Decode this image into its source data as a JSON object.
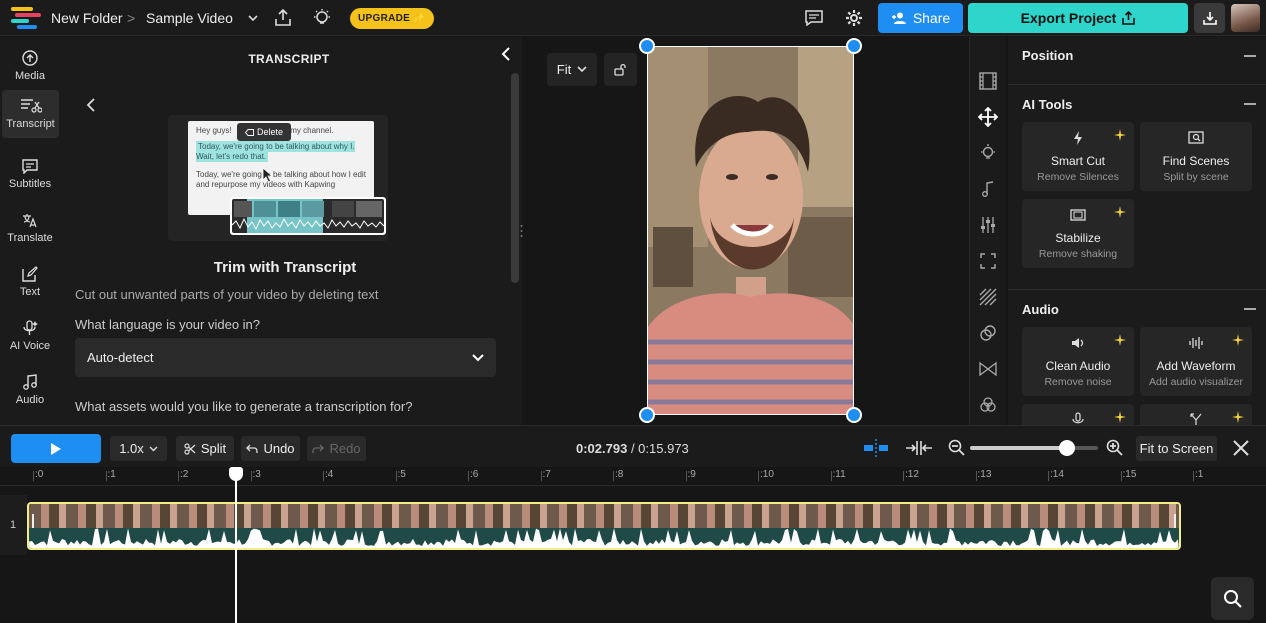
{
  "topbar": {
    "folder": "New Folder",
    "separator": ">",
    "project_name": "Sample Video",
    "upgrade_label": "UPGRADE ✨",
    "share_label": "Share",
    "export_label": "Export Project"
  },
  "left_rail": {
    "items": [
      {
        "label": "Media",
        "icon": "upload-icon"
      },
      {
        "label": "Transcript",
        "icon": "transcript-icon"
      },
      {
        "label": "Subtitles",
        "icon": "subtitles-icon"
      },
      {
        "label": "Translate",
        "icon": "translate-icon"
      },
      {
        "label": "Text",
        "icon": "text-edit-icon"
      },
      {
        "label": "AI Voice",
        "icon": "ai-voice-icon"
      },
      {
        "label": "Audio",
        "icon": "music-note-icon"
      }
    ]
  },
  "transcript": {
    "title": "TRANSCRIPT",
    "illustration": {
      "line1": "Hey guys!",
      "line1_end": "o my channel.",
      "delete_label": "Delete",
      "line2": "Today, we're going to be talking about why I. Wait, let's redo that.",
      "line3": "Today, we're going to be talking about how I edit and repurpose my videos with Kapwing"
    },
    "heading": "Trim with Transcript",
    "subtitle": "Cut out unwanted parts of your video by deleting text",
    "language_question": "What language is your video in?",
    "language_value": "Auto-detect",
    "assets_question": "What assets would you like to generate a transcription for?"
  },
  "preview": {
    "fit_label": "Fit"
  },
  "right_panel": {
    "position_title": "Position",
    "ai_tools_title": "AI Tools",
    "ai_tools": [
      {
        "title": "Smart Cut",
        "subtitle": "Remove Silences",
        "icon": "lightning-icon"
      },
      {
        "title": "Find Scenes",
        "subtitle": "Split by scene",
        "icon": "scene-search-icon"
      },
      {
        "title": "Stabilize",
        "subtitle": "Remove shaking",
        "icon": "stabilize-icon"
      }
    ],
    "audio_title": "Audio",
    "audio_tools": [
      {
        "title": "Clean Audio",
        "subtitle": "Remove noise",
        "icon": "speaker-icon"
      },
      {
        "title": "Add Waveform",
        "subtitle": "Add audio visualizer",
        "icon": "waveform-icon"
      }
    ]
  },
  "timeline_bar": {
    "speed": "1.0x",
    "split_label": "Split",
    "undo_label": "Undo",
    "redo_label": "Redo",
    "current_time": "0:02.793",
    "total_time": "/ 0:15.973",
    "zoom_level": 0.76,
    "fit_screen_label": "Fit to Screen"
  },
  "timeline": {
    "ruler": [
      ":0",
      ":1",
      ":2",
      ":3",
      ":4",
      ":5",
      ":6",
      ":7",
      ":8",
      ":9",
      ":10",
      ":11",
      ":12",
      ":13",
      ":14",
      ":15",
      ":1"
    ],
    "track_number": "1",
    "playhead_seconds": 2.793
  },
  "colors": {
    "primary": "#1e8ef2",
    "export": "#2ed5cb",
    "upgrade": "#f5c21b",
    "track_border": "#f3ec8a"
  }
}
